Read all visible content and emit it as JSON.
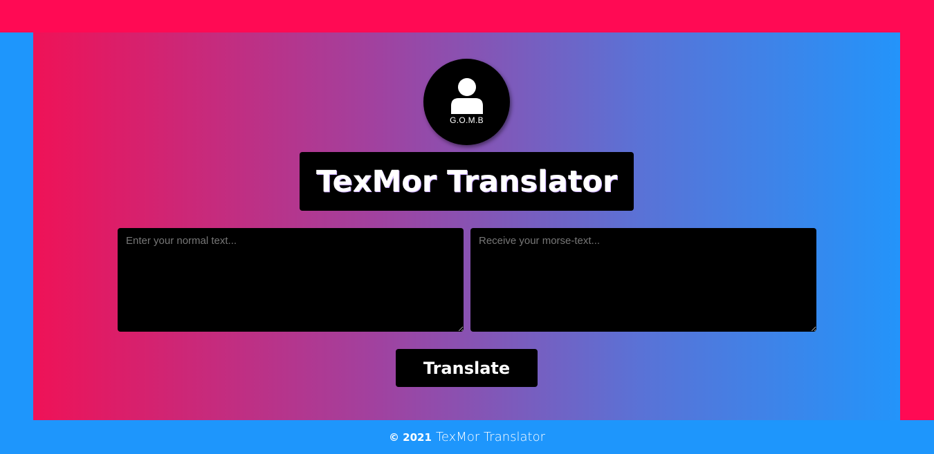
{
  "logo": {
    "text": "G.O.M.B",
    "icon": "user-icon"
  },
  "header": {
    "title": "TexMor Translator"
  },
  "input": {
    "placeholder": "Enter your normal text...",
    "value": ""
  },
  "output": {
    "placeholder": "Receive your morse-text...",
    "value": ""
  },
  "actions": {
    "translate_label": "Translate"
  },
  "footer": {
    "copyright": "© 2021",
    "name": "TexMor Translator"
  },
  "colors": {
    "pink": "#ff0a54",
    "blue": "#1e96fc",
    "black": "#000000",
    "white": "#ffffff"
  }
}
